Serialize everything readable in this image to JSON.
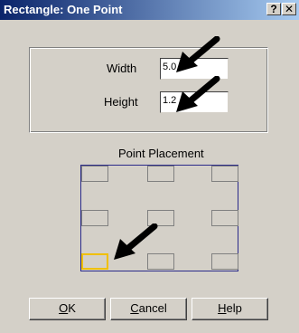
{
  "dialog": {
    "title": "Rectangle: One Point",
    "help_button": "?",
    "close_button": "✕"
  },
  "size": {
    "width_label": "Width",
    "width_value": "5.0",
    "height_label": "Height",
    "height_value": "1.2"
  },
  "placement": {
    "label": "Point Placement",
    "selected": "bottom-left"
  },
  "buttons": {
    "ok": {
      "accel": "O",
      "rest": "K"
    },
    "cancel": {
      "accel": "C",
      "rest": "ancel"
    },
    "help": {
      "accel": "H",
      "rest": "elp"
    }
  },
  "colors": {
    "title_bar_start": "#0a246a",
    "title_bar_end": "#a6caf0",
    "selection": "#f0c000",
    "frame": "#2a2a8a"
  }
}
